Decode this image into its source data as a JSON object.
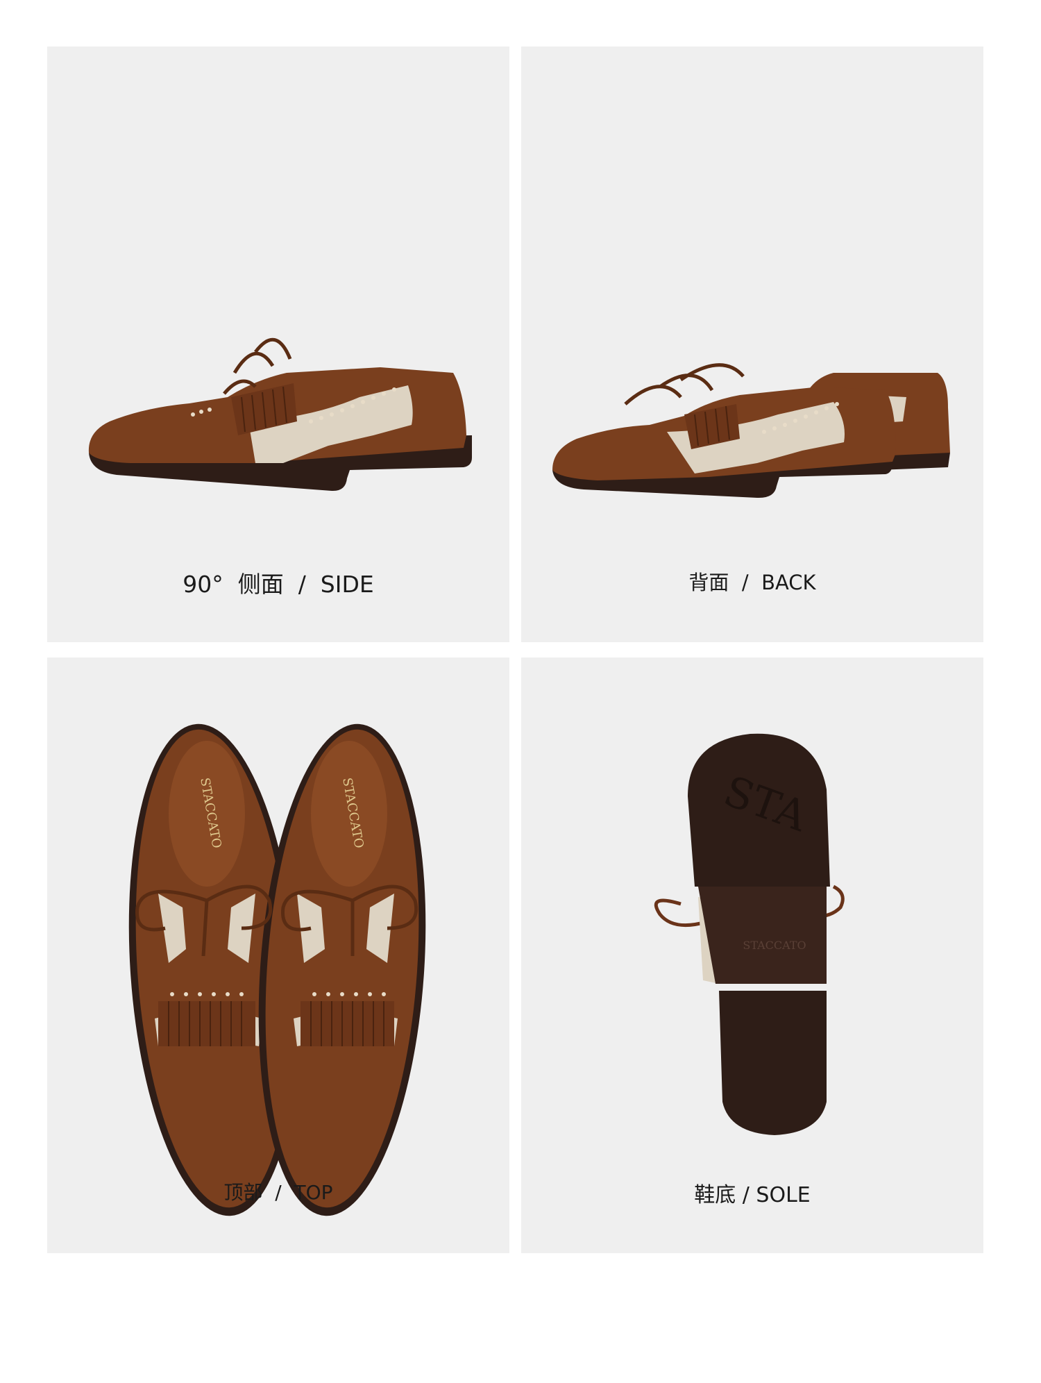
{
  "panels": [
    {
      "id": "side",
      "caption": "90°  侧面  /  SIDE",
      "view": "side-view"
    },
    {
      "id": "back",
      "caption": "背面  /  BACK",
      "view": "back-view"
    },
    {
      "id": "top",
      "caption": "顶部  /  TOP",
      "view": "top-view"
    },
    {
      "id": "sole",
      "caption": "鞋底 / SOLE",
      "view": "sole-view"
    }
  ],
  "brand_marks": {
    "insole": "STACCATO",
    "sole_logo": "STA",
    "sole_heel": "STACCATO"
  },
  "colors": {
    "panel_bg": "#efefef",
    "leather": "#7a3f1e",
    "leather_dark": "#5a2c13",
    "canvas": "#ddd3c2",
    "sole": "#2e1d17",
    "caption_text": "#1a1a1a"
  }
}
